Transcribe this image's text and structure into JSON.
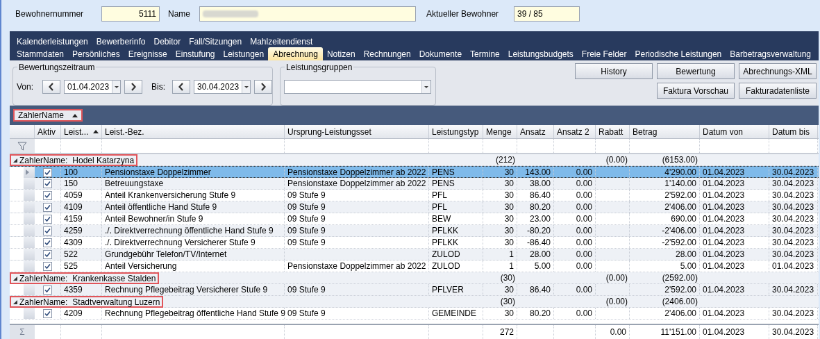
{
  "header": {
    "resident_number_label": "Bewohnernummer",
    "resident_number": "5111",
    "name_label": "Name",
    "current_label": "Aktueller Bewohner",
    "current": "39 / 85"
  },
  "tab_rows": [
    [
      {
        "label": "Kalenderleistungen",
        "selected": false
      },
      {
        "label": "Bewerberinfo",
        "selected": false
      },
      {
        "label": "Debitor",
        "selected": false
      },
      {
        "label": "Fall/Sitzungen",
        "selected": false
      },
      {
        "label": "Mahlzeitendienst",
        "selected": false
      }
    ],
    [
      {
        "label": "Stammdaten",
        "selected": false
      },
      {
        "label": "Persönliches",
        "selected": false
      },
      {
        "label": "Ereignisse",
        "selected": false
      },
      {
        "label": "Einstufung",
        "selected": false
      },
      {
        "label": "Leistungen",
        "selected": false
      },
      {
        "label": "Abrechnung",
        "selected": true
      },
      {
        "label": "Notizen",
        "selected": false
      },
      {
        "label": "Rechnungen",
        "selected": false
      },
      {
        "label": "Dokumente",
        "selected": false
      },
      {
        "label": "Termine",
        "selected": false
      },
      {
        "label": "Leistungsbudgets",
        "selected": false
      },
      {
        "label": "Freie Felder",
        "selected": false
      },
      {
        "label": "Periodische Leistungen",
        "selected": false
      },
      {
        "label": "Barbetragsverwaltung",
        "selected": false
      }
    ]
  ],
  "period": {
    "title": "Bewertungszeitraum",
    "from_label": "Von:",
    "from": "01.04.2023",
    "to_label": "Bis:",
    "to": "30.04.2023"
  },
  "groups_filter": {
    "title": "Leistungsgruppen"
  },
  "buttons": [
    [
      "History",
      "Bewertung",
      "Abrechnungs-XML"
    ],
    [
      "Faktura Vorschau",
      "Fakturadatenliste"
    ]
  ],
  "group_by": {
    "label": "ZahlerName",
    "sorted": true,
    "highlighted": true
  },
  "columns": [
    {
      "label": "Aktiv"
    },
    {
      "label": "Leist...",
      "sorted": true
    },
    {
      "label": "Leist.-Bez."
    },
    {
      "label": "Ursprung-Leistungsset"
    },
    {
      "label": "Leistungstyp"
    },
    {
      "label": "Menge"
    },
    {
      "label": "Ansatz"
    },
    {
      "label": "Ansatz 2"
    },
    {
      "label": "Rabatt"
    },
    {
      "label": "Betrag"
    },
    {
      "label": "Datum von"
    },
    {
      "label": "Datum bis"
    }
  ],
  "groups": [
    {
      "label": "ZahlerName:",
      "value": "Hodel Katarzyna",
      "expanded": true,
      "highlighted": true,
      "menge": "(212)",
      "rabatt": "(0.00)",
      "betrag": "(6153.00)",
      "rows": [
        {
          "selected": true,
          "aktiv": true,
          "cells": [
            "100",
            "Pensionstaxe Doppelzimmer",
            "Pensionstaxe Doppelzimmer ab 2022",
            "PENS",
            "30",
            "143.00",
            "0.00",
            "",
            "4'290.00",
            "01.04.2023",
            "30.04.2023"
          ]
        },
        {
          "selected": false,
          "aktiv": true,
          "cells": [
            "150",
            "Betreuungstaxe",
            "Pensionstaxe Doppelzimmer ab 2022",
            "PENS",
            "30",
            "38.00",
            "0.00",
            "",
            "1'140.00",
            "01.04.2023",
            "30.04.2023"
          ]
        },
        {
          "selected": false,
          "aktiv": true,
          "cells": [
            "4059",
            "Anteil Krankenversicherung Stufe 9",
            "09 Stufe 9",
            "PFL",
            "30",
            "86.40",
            "0.00",
            "",
            "2'592.00",
            "01.04.2023",
            "30.04.2023"
          ]
        },
        {
          "selected": false,
          "aktiv": true,
          "cells": [
            "4109",
            "Anteil öffentliche Hand Stufe 9",
            "09 Stufe 9",
            "PFL",
            "30",
            "80.20",
            "0.00",
            "",
            "2'406.00",
            "01.04.2023",
            "30.04.2023"
          ]
        },
        {
          "selected": false,
          "aktiv": true,
          "cells": [
            "4159",
            "Anteil Bewohner/in Stufe 9",
            "09 Stufe 9",
            "BEW",
            "30",
            "23.00",
            "0.00",
            "",
            "690.00",
            "01.04.2023",
            "30.04.2023"
          ]
        },
        {
          "selected": false,
          "aktiv": true,
          "cells": [
            "4259",
            "./. Direktverrechnung öffentliche Hand Stufe 9",
            "09 Stufe 9",
            "PFLKK",
            "30",
            "-80.20",
            "0.00",
            "",
            "-2'406.00",
            "01.04.2023",
            "30.04.2023"
          ]
        },
        {
          "selected": false,
          "aktiv": true,
          "cells": [
            "4309",
            "./. Direktverrechnung Versicherer Stufe 9",
            "09 Stufe 9",
            "PFLKK",
            "30",
            "-86.40",
            "0.00",
            "",
            "-2'592.00",
            "01.04.2023",
            "30.04.2023"
          ]
        },
        {
          "selected": false,
          "aktiv": true,
          "cells": [
            "522",
            "Grundgebühr Telefon/TV/Internet",
            "",
            "ZULOD",
            "1",
            "28.00",
            "0.00",
            "",
            "28.00",
            "01.04.2023",
            "30.04.2023"
          ]
        },
        {
          "selected": false,
          "aktiv": true,
          "cells": [
            "525",
            "Anteil Versicherung",
            "Pensionstaxe Doppelzimmer ab 2022",
            "ZULOD",
            "1",
            "5.00",
            "0.00",
            "",
            "5.00",
            "01.04.2023",
            "01.04.2023"
          ]
        }
      ]
    },
    {
      "label": "ZahlerName:",
      "value": "Krankenkasse Stalden",
      "expanded": true,
      "highlighted": true,
      "menge": "(30)",
      "rabatt": "(0.00)",
      "betrag": "(2592.00)",
      "rows": [
        {
          "selected": false,
          "aktiv": true,
          "cells": [
            "4359",
            "Rechnung Pflegebeitrag Versicherer Stufe 9",
            "09 Stufe 9",
            "PFLVER",
            "30",
            "86.40",
            "0.00",
            "",
            "2'592.00",
            "01.04.2023",
            "30.04.2023"
          ]
        }
      ]
    },
    {
      "label": "ZahlerName:",
      "value": "Stadtverwaltung Luzern",
      "expanded": true,
      "highlighted": true,
      "menge": "(30)",
      "rabatt": "(0.00)",
      "betrag": "(2406.00)",
      "rows": [
        {
          "selected": false,
          "aktiv": true,
          "cells": [
            "4209",
            "Rechnung Pflegebeitrag öffentliche Hand Stufe 9",
            "09 Stufe 9",
            "GEMEINDE",
            "30",
            "80.20",
            "0.00",
            "",
            "2'406.00",
            "01.04.2023",
            "30.04.2023"
          ]
        }
      ]
    }
  ],
  "totals": {
    "symbol": "Σ",
    "cells": [
      "",
      "",
      "",
      "",
      "",
      "",
      "272",
      "",
      "",
      "0.00",
      "11'151.00",
      "01.04.2023",
      "30.04.2023"
    ]
  }
}
